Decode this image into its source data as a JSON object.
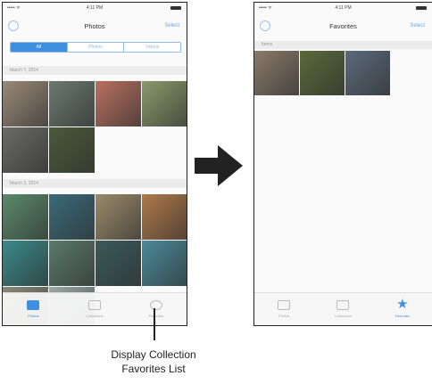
{
  "left_screen": {
    "status": {
      "carrier": "••••• ᯤ",
      "time": "4:11 PM"
    },
    "nav": {
      "title": "Photos",
      "right_button": "Select"
    },
    "segments": [
      "All",
      "Photos",
      "Videos"
    ],
    "sections": [
      {
        "header": "March 7, 2014",
        "photo_colors": [
          "#9a8a78",
          "#6a7a70",
          "#b87060",
          "#8a9a6a",
          "#6a6a66",
          "#4a5a3a"
        ]
      },
      {
        "header": "March 3, 2014",
        "photo_colors": [
          "#5a8a6a",
          "#3a6a7a",
          "#9a8a6a",
          "#b07a4a",
          "#3a8a8a",
          "#5a7a6a",
          "#3a5a5a",
          "#4a8a9a",
          "#8a8a7a",
          "#9aaaa8"
        ]
      }
    ],
    "tabs": [
      {
        "label": "Photos",
        "icon": "photos-icon",
        "active": true
      },
      {
        "label": "Collections",
        "icon": "collections-icon",
        "active": false
      },
      {
        "label": "Favorites",
        "icon": "favorites-icon",
        "active": false
      }
    ]
  },
  "right_screen": {
    "status": {
      "carrier": "••••• ᯤ",
      "time": "4:11 PM"
    },
    "nav": {
      "title": "Favorites",
      "right_button": "Select"
    },
    "section_header": "Items",
    "photo_colors": [
      "#8a7a6a",
      "#5a6a3a",
      "#5a6a7a"
    ],
    "tabs": [
      {
        "label": "Photos",
        "icon": "photos-icon",
        "active": false
      },
      {
        "label": "Collections",
        "icon": "collections-icon",
        "active": false
      },
      {
        "label": "Favorites",
        "icon": "star-icon",
        "active": true
      }
    ]
  },
  "caption": {
    "line1": "Display Collection",
    "line2": "Favorites List"
  },
  "colors": {
    "accent": "#3f8fe0",
    "arrow": "#222222"
  }
}
